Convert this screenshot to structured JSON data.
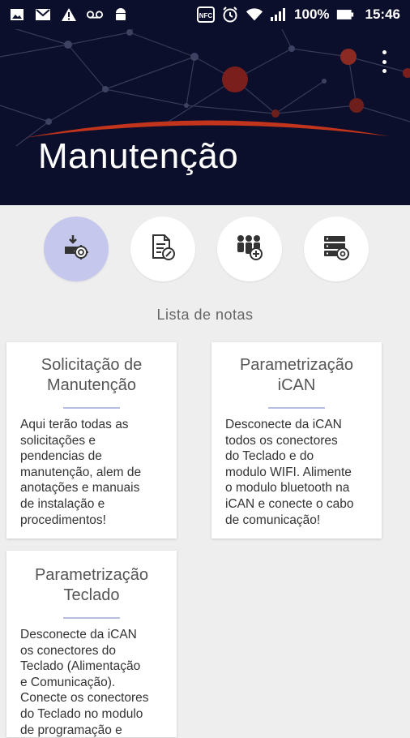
{
  "status_bar": {
    "battery": "100%",
    "time": "15:46",
    "left_icons": [
      "image-icon",
      "gmail-icon",
      "warning-icon",
      "voicemail-icon",
      "android-icon"
    ],
    "right_icons": [
      "nfc-icon",
      "alarm-icon",
      "wifi-icon",
      "signal-icon",
      "battery-icon"
    ]
  },
  "header": {
    "title": "Manutenção",
    "accent_color": "#c2341b",
    "background": "#0c0f2b"
  },
  "actions": [
    {
      "name": "maintenance-request",
      "icon": "hand-gear-icon",
      "active": true
    },
    {
      "name": "document-edit",
      "icon": "document-pen-icon",
      "active": false
    },
    {
      "name": "team-add",
      "icon": "people-add-icon",
      "active": false
    },
    {
      "name": "server-settings",
      "icon": "server-gear-icon",
      "active": false
    }
  ],
  "notes": {
    "section_title": "Lista de notas",
    "items": [
      {
        "title_line1": "Solicitação de",
        "title_line2": "Manutenção",
        "body": [
          "Aqui terão todas as",
          "solicitações e",
          "pendencias de",
          "manutenção, alem de",
          "anotações e manuais",
          "de instalação e",
          "procedimentos!"
        ]
      },
      {
        "title_line1": "Parametrização",
        "title_line2": "iCAN",
        "body": [
          "Desconecte da iCAN",
          "todos os conectores",
          "do Teclado e do",
          "modulo WIFI. Alimente",
          "o modulo bluetooth na",
          "iCAN e conecte o cabo",
          "de comunicação!"
        ]
      },
      {
        "title_line1": "Parametrização",
        "title_line2": "Teclado",
        "body": [
          "Desconecte da iCAN",
          "os conectores do",
          "Teclado (Alimentação",
          "e Comunicação).",
          "Conecte os conectores",
          "do Teclado no modulo",
          "de programação e"
        ]
      }
    ]
  }
}
